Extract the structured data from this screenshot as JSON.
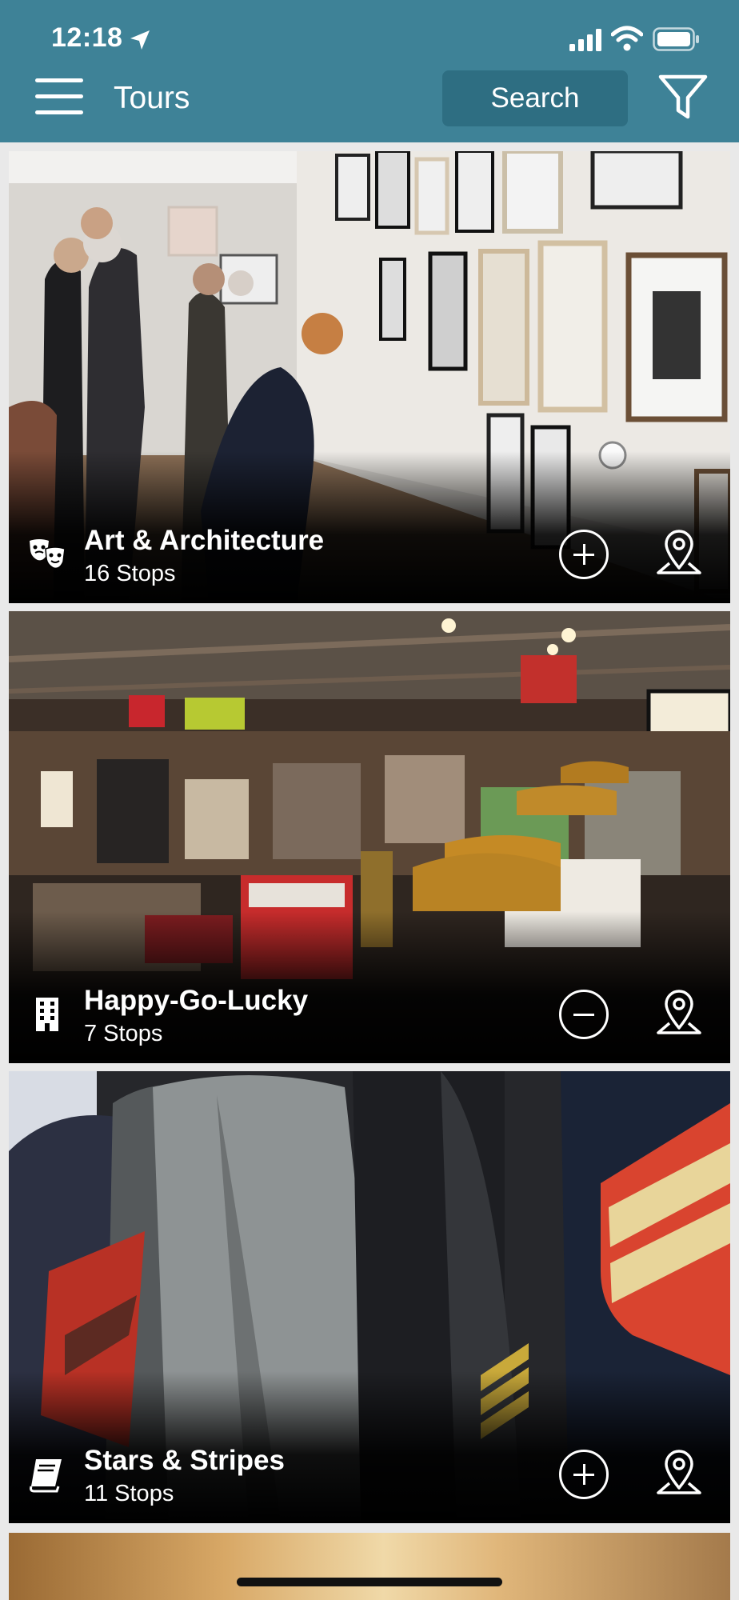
{
  "status_bar": {
    "time": "12:18"
  },
  "header": {
    "title": "Tours",
    "search_label": "Search"
  },
  "tours": [
    {
      "title": "Art & Architecture",
      "stops": "16 Stops",
      "category_icon": "theater-masks-icon",
      "action": "add"
    },
    {
      "title": "Happy-Go-Lucky",
      "stops": "7 Stops",
      "category_icon": "building-icon",
      "action": "remove"
    },
    {
      "title": "Stars & Stripes",
      "stops": "11 Stops",
      "category_icon": "book-icon",
      "action": "add"
    }
  ],
  "colors": {
    "header": "#3e8297",
    "search_button": "#2e6e82",
    "background": "#e9e9e9"
  }
}
